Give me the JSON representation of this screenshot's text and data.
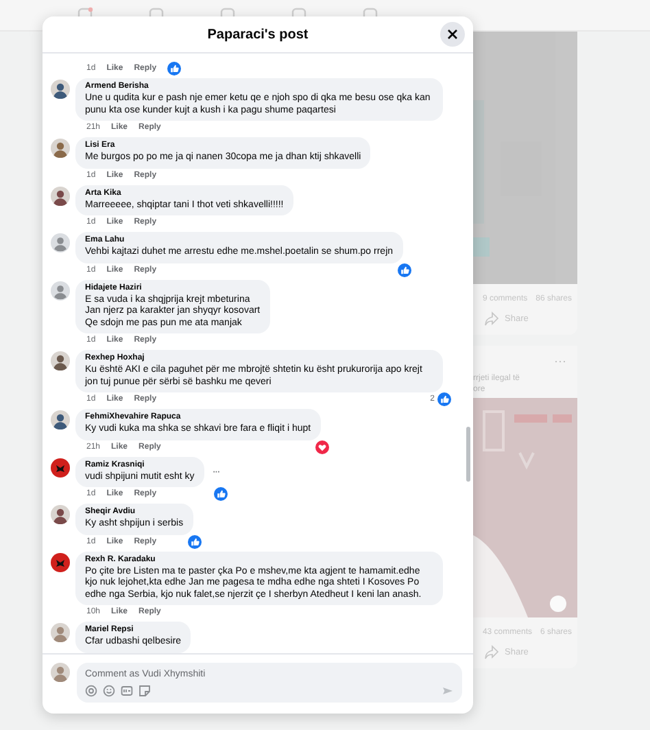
{
  "feed": {
    "cards": [
      {
        "stats": [
          "9 comments",
          "86 shares"
        ],
        "share": "Share"
      },
      {
        "kind": "post",
        "more": "···",
        "text": [
          "rrjeti ilegal të",
          "ore"
        ],
        "stats": [
          "43 comments",
          "6 shares"
        ],
        "share": "Share"
      }
    ]
  },
  "modal": {
    "title": "Paparaci's post",
    "comments": [
      {
        "time": "1d",
        "actions": [
          "Like",
          "Reply"
        ],
        "reaction": {
          "kind": "like"
        }
      },
      {
        "name": "Armend Berisha",
        "text": "Une u qudita kur e pash nje emer ketu qe e njoh spo di qka me besu ose qka kan punu kta ose kunder kujt a kush i ka pagu shume paqartesi",
        "time": "21h",
        "actions": [
          "Like",
          "Reply"
        ]
      },
      {
        "name": "Lisi Era",
        "text": "Me burgos po po me ja qi nanen 30copa me ja dhan ktij shkavelli",
        "time": "1d",
        "actions": [
          "Like",
          "Reply"
        ]
      },
      {
        "name": "Arta Kika",
        "text": "Marreeeee, shqiptar tani I thot veti shkavelli!!!!!",
        "time": "1d",
        "actions": [
          "Like",
          "Reply"
        ]
      },
      {
        "avatar": {
          "kind": "default"
        },
        "name": "Ema Lahu",
        "text": "Vehbi kajtazi duhet me arrestu edhe me.mshel.poetalin se shum.po rrejn",
        "time": "1d",
        "actions": [
          "Like",
          "Reply"
        ],
        "reaction": {
          "kind": "like"
        }
      },
      {
        "avatar": {
          "kind": "default"
        },
        "name": "Hidajete Haziri",
        "text": "E sa vuda i ka shqjprija krejt mbeturina\nJan njerz pa karakter jan shyqyr kosovart\nQe sdojn me pas pun me ata manjak",
        "time": "1d",
        "actions": [
          "Like",
          "Reply"
        ]
      },
      {
        "name": "Rexhep Hoxhaj",
        "text": "Ku është AKI e cila paguhet për me mbrojtë shtetin ku ësht prukurorija apo krejt jon tuj punue për sërbi së bashku me qeveri",
        "time": "1d",
        "actions": [
          "Like",
          "Reply"
        ],
        "reaction": {
          "kind": "like",
          "count": "2"
        }
      },
      {
        "name": "FehmiXhevahire Rapuca",
        "text": "Ky vudi kuka ma shka se shkavi bre fara e fliqit i hupt",
        "time": "21h",
        "actions": [
          "Like",
          "Reply"
        ],
        "reaction": {
          "kind": "love"
        }
      },
      {
        "avatar": {
          "kind": "flag"
        },
        "name": "Ramiz Krasniqi",
        "text": "vudi shpijuni mutit esht ky",
        "time": "1d",
        "actions": [
          "Like",
          "Reply"
        ],
        "reaction": {
          "kind": "like"
        },
        "more": "···"
      },
      {
        "name": "Sheqir Avdiu",
        "text": "Ky asht shpijun i serbis",
        "time": "1d",
        "actions": [
          "Like",
          "Reply"
        ],
        "reaction": {
          "kind": "like"
        }
      },
      {
        "avatar": {
          "kind": "flag"
        },
        "name": "Rexh R. Karadaku",
        "text": "Po çite bre Listen ma te paster çka Po e mshev,me kta agjent te hamamit.edhe kjo nuk lejohet,kta edhe Jan me pagesa te mdha edhe nga shteti I Kosoves Po edhe nga Serbia, kjo nuk falet,se njerzit çe I sherbyn Atedheut I keni lan anash.",
        "time": "10h",
        "actions": [
          "Like",
          "Reply"
        ]
      },
      {
        "name": "Mariel Repsi",
        "text": "Cfar udbashi qelbesire"
      }
    ],
    "composer": {
      "placeholder": "Comment as Vudi Xhymshiti"
    }
  }
}
